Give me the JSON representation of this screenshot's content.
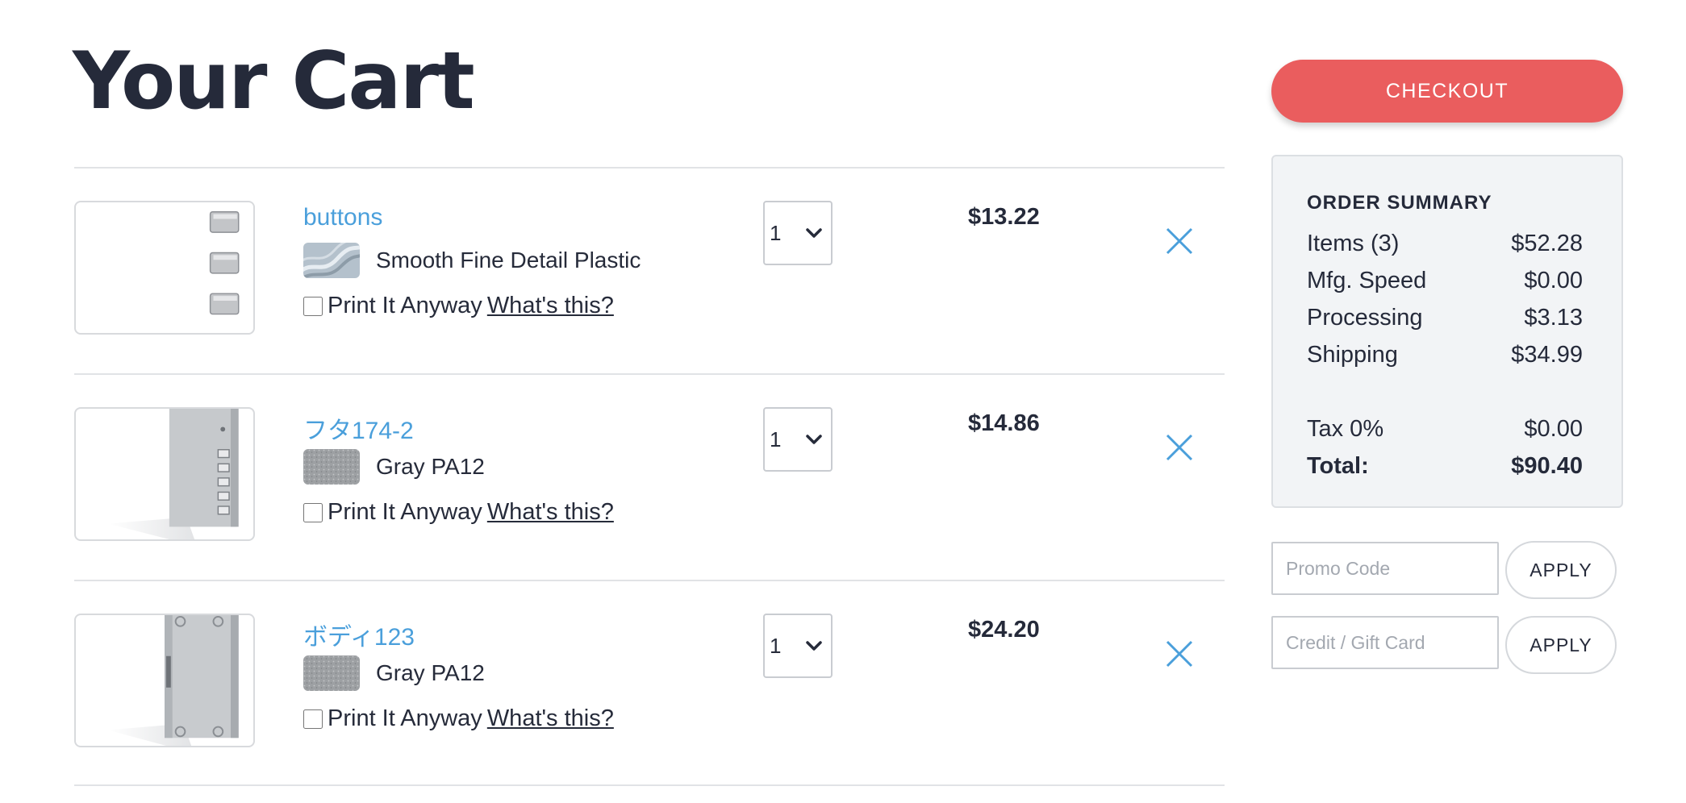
{
  "page": {
    "title": "Your Cart"
  },
  "cart": {
    "items": [
      {
        "name": "buttons",
        "material": "Smooth Fine Detail Plastic",
        "print_anyway": "Print It Anyway",
        "whats_this": "What's this?",
        "quantity": "1",
        "price": "$13.22",
        "swatch_color": "#b4c1cc"
      },
      {
        "name": "フタ174-2",
        "material": "Gray PA12",
        "print_anyway": "Print It Anyway",
        "whats_this": "What's this?",
        "quantity": "1",
        "price": "$14.86",
        "swatch_color": "#9da0a3"
      },
      {
        "name": "ボディ123",
        "material": "Gray PA12",
        "print_anyway": "Print It Anyway",
        "whats_this": "What's this?",
        "quantity": "1",
        "price": "$24.20",
        "swatch_color": "#9da0a3"
      }
    ]
  },
  "checkout": {
    "label": "CHECKOUT",
    "color": "#ea5d5e"
  },
  "summary": {
    "title": "ORDER SUMMARY",
    "rows": [
      {
        "label": "Items (3)",
        "value": "$52.28"
      },
      {
        "label": "Mfg. Speed",
        "value": "$0.00"
      },
      {
        "label": "Processing",
        "value": "$3.13"
      },
      {
        "label": "Shipping",
        "value": "$34.99"
      },
      {
        "label": "Tax 0%",
        "value": "$0.00"
      }
    ],
    "total": {
      "label": "Total:",
      "value": "$90.40"
    }
  },
  "promo": {
    "placeholder": "Promo Code",
    "apply_label": "APPLY"
  },
  "credit": {
    "placeholder": "Credit / Gift Card",
    "apply_label": "APPLY"
  },
  "colors": {
    "link": "#4a9fdb",
    "text": "#252a3a",
    "remove_icon": "#4a9fdb"
  },
  "icons": {
    "remove": "close-icon",
    "quantity": "chevron-down-icon"
  }
}
